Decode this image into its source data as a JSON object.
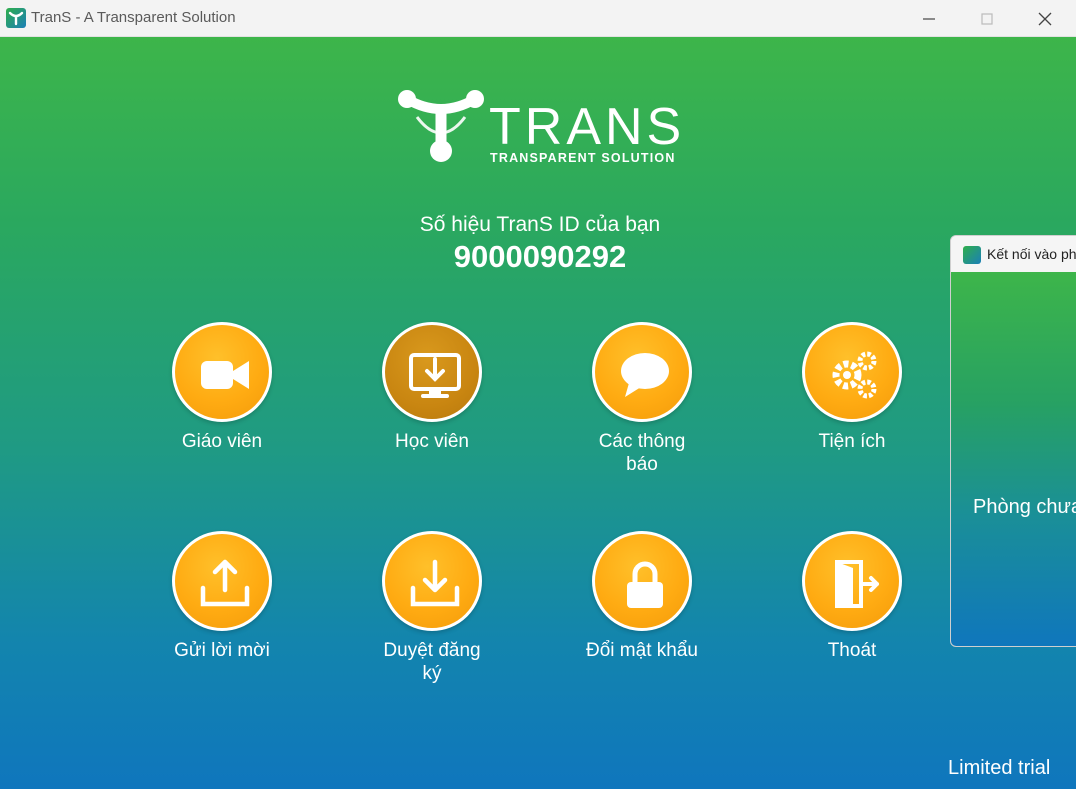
{
  "window": {
    "title": "TranS - A Transparent Solution"
  },
  "logo": {
    "word": "TRANS",
    "tagline": "TRANSPARENT SOLUTION"
  },
  "user": {
    "id_label": "Số hiệu TranS ID của bạn",
    "id_value": "9000090292"
  },
  "menu": [
    {
      "label": "Giáo viên",
      "icon": "video-camera-icon"
    },
    {
      "label": "Học viên",
      "icon": "monitor-download-icon",
      "active": true
    },
    {
      "label": "Các thông báo",
      "icon": "chat-bubble-icon"
    },
    {
      "label": "Tiện ích",
      "icon": "gears-icon"
    },
    {
      "label": "Gửi lời mời",
      "icon": "upload-tray-icon"
    },
    {
      "label": "Duyệt đăng ký",
      "icon": "download-tray-icon"
    },
    {
      "label": "Đổi mật khẩu",
      "icon": "lock-icon"
    },
    {
      "label": "Thoát",
      "icon": "exit-door-icon"
    }
  ],
  "secondary_window": {
    "title": "Kết nối vào ph",
    "room_text": "Phòng chưa"
  },
  "status": {
    "trial": "Limited trial"
  },
  "colors": {
    "gradient_top": "#3db54a",
    "gradient_bottom": "#0f76bd",
    "button_orange": "#ffab12",
    "button_active": "#c98611"
  }
}
